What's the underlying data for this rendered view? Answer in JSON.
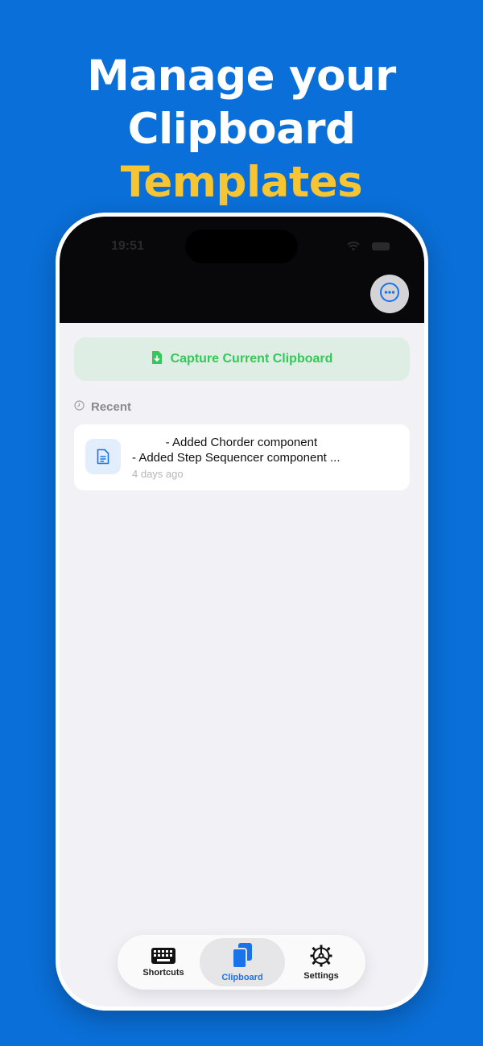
{
  "headline": {
    "line1": "Manage your",
    "line2_white": "Clipboard ",
    "line2_accent": "Templates"
  },
  "status": {
    "time": "19:51"
  },
  "capture_button": {
    "label": "Capture Current Clipboard"
  },
  "recent": {
    "header": "Recent",
    "items": [
      {
        "text": "          - Added Chorder component\n- Added Step Sequencer component ...",
        "time": "4 days ago"
      }
    ]
  },
  "tabs": [
    {
      "label": "Shortcuts",
      "icon": "keyboard-icon",
      "active": false
    },
    {
      "label": "Clipboard",
      "icon": "clipboard-icon",
      "active": true
    },
    {
      "label": "Settings",
      "icon": "gear-icon",
      "active": false
    }
  ],
  "colors": {
    "background": "#0a6fd8",
    "accent": "#f6c531",
    "success": "#34c759",
    "tab_active": "#1a73e8"
  }
}
